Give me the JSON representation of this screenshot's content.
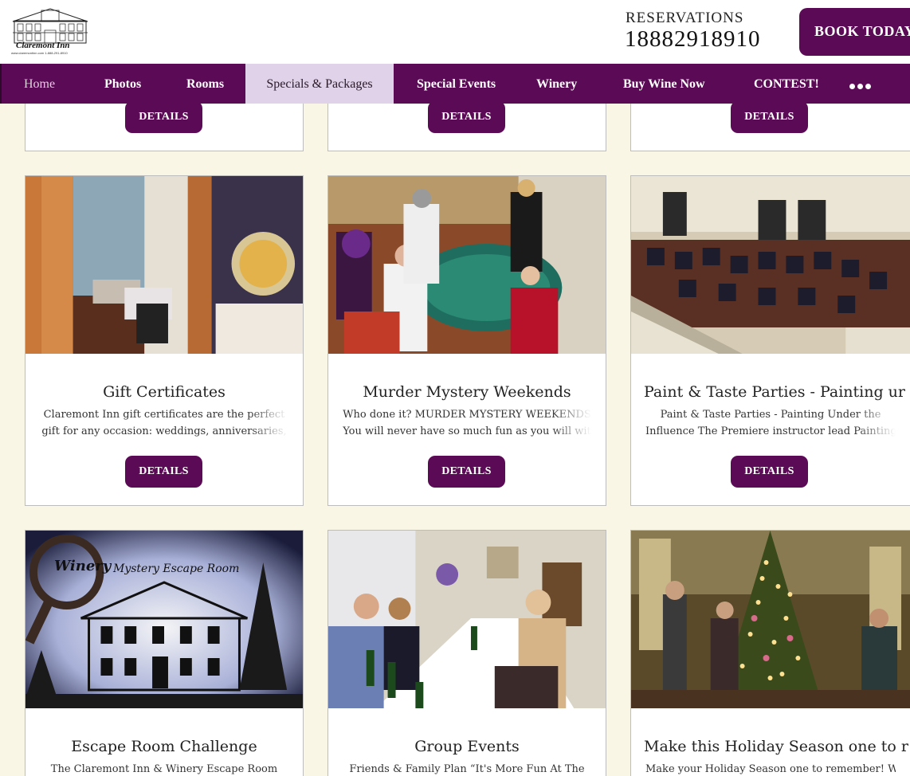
{
  "header": {
    "logo_name": "Claremont Inn",
    "logo_sub": "www.claremontinn.com   1-888-291-8910",
    "reservations_label": "RESERVATIONS",
    "phone": "18882918910",
    "book_label": "BOOK TODAY"
  },
  "nav": {
    "items": [
      "Home",
      "Photos",
      "Rooms",
      "Specials & Packages",
      "Special Events",
      "Winery",
      "Buy Wine Now",
      "CONTEST!"
    ],
    "active": "Specials & Packages",
    "more_icon": "more-dots-icon"
  },
  "details_label": "DETAILS",
  "cards": [
    {
      "title": "Gift Certificates",
      "desc_line1": "Claremont Inn gift certificates are the perfect",
      "desc_line2": "gift for any occasion: weddings, anniversaries,"
    },
    {
      "title": "Murder Mystery Weekends",
      "desc_line1": "Who done it?  MURDER MYSTERY WEEKENDS",
      "desc_line2": "You will never have so much fun as you will wit"
    },
    {
      "title": "Paint & Taste Parties - Painting ur",
      "desc_line1": "Paint & Taste Parties - Painting Under the",
      "desc_line2": "Influence The Premiere instructor lead Painting"
    },
    {
      "title": "Escape Room Challenge",
      "desc_line1": "The Claremont Inn & Winery Escape Room"
    },
    {
      "title": "Group Events",
      "desc_line1": "Friends & Family Plan “It's More Fun At The"
    },
    {
      "title": "Make this Holiday Season one to r",
      "desc_line1": "Make your Holiday Season one to remember! We"
    }
  ],
  "images": {
    "escape_room_winery": "Winery",
    "escape_room_caption": "Mystery Escape Room"
  },
  "colors": {
    "brand_purple": "#5b0a55",
    "active_tab": "#e0d2e8",
    "page_background": "#faf6e6"
  }
}
